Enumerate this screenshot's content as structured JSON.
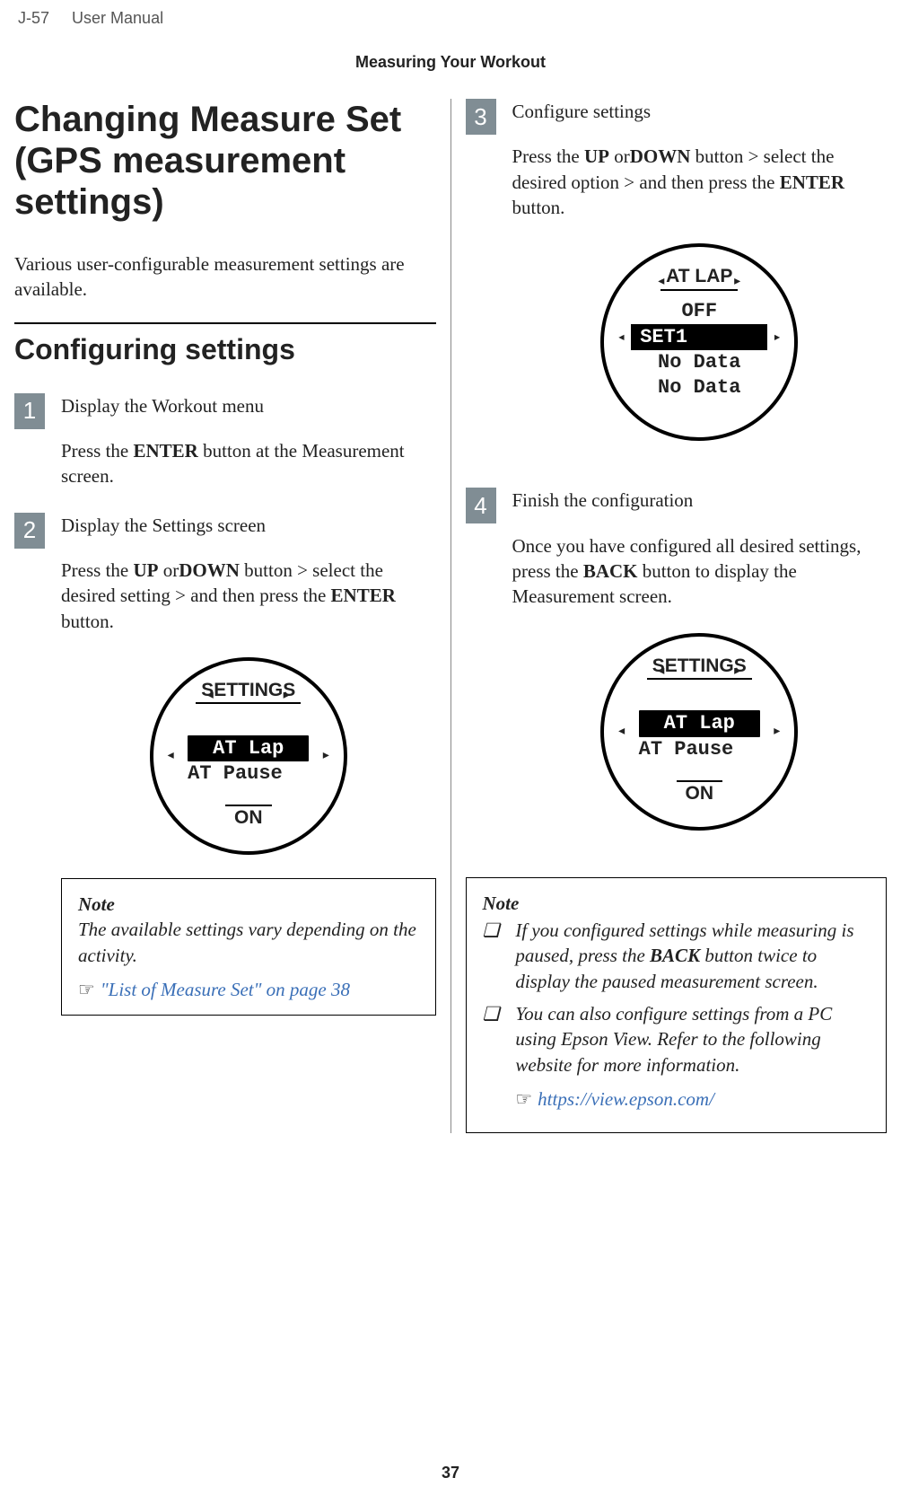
{
  "header": {
    "model": "J-57",
    "doc": "User Manual",
    "section": "Measuring Your Workout"
  },
  "title": "Changing Measure Set (GPS measurement settings)",
  "intro": "Various user-configurable measurement settings are available.",
  "subheading": "Configuring settings",
  "steps": {
    "s1": {
      "num": "1",
      "title": "Display the Workout menu",
      "desc_pre": "Press the ",
      "desc_b1": "ENTER",
      "desc_post": " button at the Measurement screen."
    },
    "s2": {
      "num": "2",
      "title": "Display the Settings screen",
      "desc_pre": "Press the ",
      "b1": "UP",
      "mid1": " or",
      "b2": "DOWN",
      "mid2": " button > select the desired setting > and then press the ",
      "b3": "ENTER",
      "desc_post": " button."
    },
    "s3": {
      "num": "3",
      "title": "Configure settings",
      "desc_pre": "Press the ",
      "b1": "UP",
      "mid1": " or",
      "b2": "DOWN",
      "mid2": " button > select the desired option > and then press the ",
      "b3": "ENTER",
      "desc_post": " button."
    },
    "s4": {
      "num": "4",
      "title": "Finish the configuration",
      "desc_pre": "Once you have configured all desired settings, press the ",
      "b1": "BACK",
      "desc_post": " button to display the Measurement screen."
    }
  },
  "watch_settings": {
    "top": "SETTINGS",
    "sel": "AT Lap",
    "line2": "AT Pause",
    "bottom": "ON"
  },
  "watch_atlap": {
    "top": "AT LAP",
    "line1": "OFF",
    "sel": "SET1",
    "line3": "No Data",
    "line4": "No Data"
  },
  "note1": {
    "label": "Note",
    "text": "The available settings vary depending on the activity.",
    "ref": "\"List of Measure Set\" on page 38"
  },
  "note2": {
    "label": "Note",
    "bullet": "❏",
    "item1_pre": "If you configured settings while measuring is paused, press the ",
    "item1_b": "BACK",
    "item1_post": " button twice to display the paused measurement screen.",
    "item2": "You can also configure settings from a PC using Epson View. Refer to the following website for more information.",
    "url": "https://view.epson.com/"
  },
  "hand": "☞",
  "pageno": "37"
}
